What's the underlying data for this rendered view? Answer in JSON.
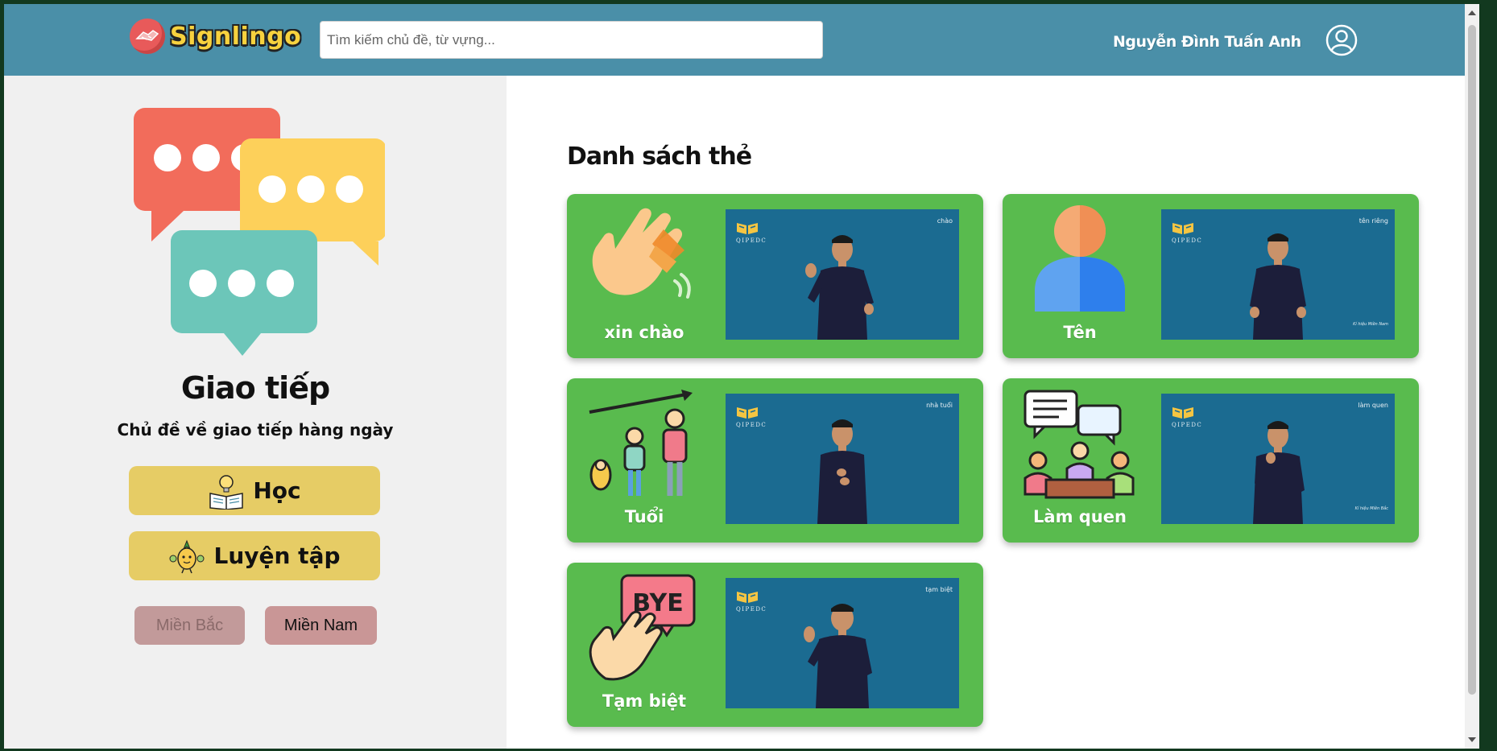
{
  "app": {
    "name": "Signlingo",
    "search_placeholder": "Tìm kiếm chủ đề, từ vựng...",
    "username": "Nguyễn Đình Tuấn Anh"
  },
  "topic": {
    "title": "Giao tiếp",
    "description": "Chủ đề về giao tiếp hàng ngày",
    "learn_label": "Học",
    "practice_label": "Luyện tập",
    "region_north": "Miền Bắc",
    "region_south": "Miền Nam"
  },
  "main": {
    "title": "Danh sách thẻ"
  },
  "cards": [
    {
      "label": "xin chào",
      "caption": "chào",
      "footer": "",
      "icon": "waving-hand-icon"
    },
    {
      "label": "Tên",
      "caption": "tên riêng",
      "footer": "Kí hiệu Miền Nam",
      "icon": "person-icon"
    },
    {
      "label": "Tuổi",
      "caption": "nhà tuổi",
      "footer": "",
      "icon": "age-growth-icon"
    },
    {
      "label": "Làm quen",
      "caption": "làm quen",
      "footer": "Kí hiệu Miền Bắc",
      "icon": "meeting-people-icon"
    },
    {
      "label": "Tạm biệt",
      "caption": "tạm biệt",
      "footer": "",
      "icon": "bye-hand-icon"
    }
  ],
  "video": {
    "logo_text": "QIPEDC"
  },
  "colors": {
    "header": "#4a8fa8",
    "card": "#59bb4e",
    "action_button": "#e6cc65",
    "video_bg": "#1b6b91"
  }
}
